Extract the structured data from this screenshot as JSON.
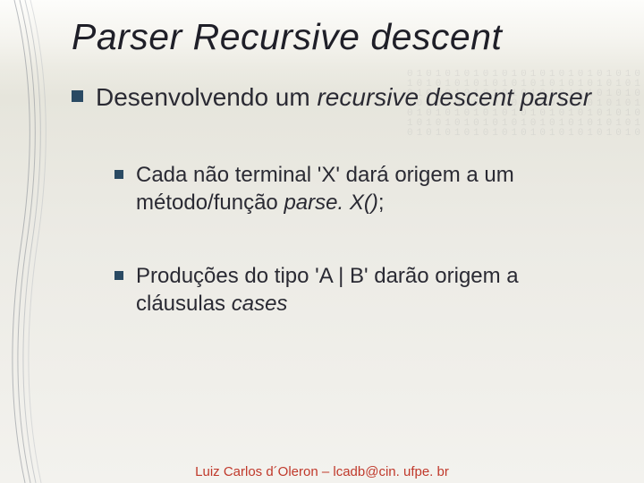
{
  "title": "Parser Recursive descent",
  "lvl1": {
    "pre": "Desenvolvendo um ",
    "italic": "recursive descent parser"
  },
  "sub": [
    {
      "pre": "Cada não terminal 'X' dará origem a um método/função ",
      "italic": "parse. X()",
      "post": ";"
    },
    {
      "pre": "Produções do tipo 'A | B' darão origem a cláusulas ",
      "italic": "cases",
      "post": ""
    }
  ],
  "footer": "Luiz Carlos d´Oleron – lcadb@cin. ufpe. br",
  "digits_texture": "0101010101010101010101010\n1010101010101010101010101\n0101010101010101010101010\n1010101010101010101010101\n0101010101010101010101010\n1010101010101010101010101\n0101010101010101010101010"
}
